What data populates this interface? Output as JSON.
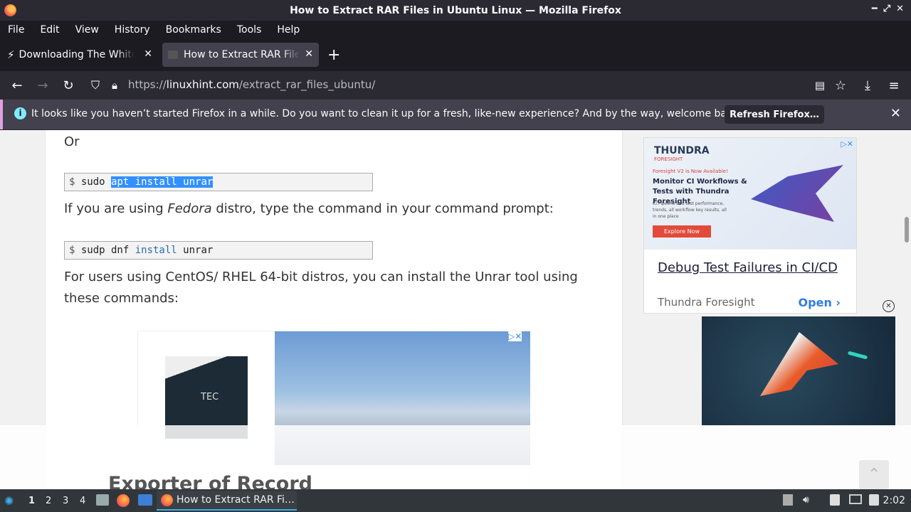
{
  "window": {
    "title": "How to Extract RAR Files in Ubuntu Linux — Mozilla Firefox"
  },
  "menu": [
    "File",
    "Edit",
    "View",
    "History",
    "Bookmarks",
    "Tools",
    "Help"
  ],
  "tabs": [
    {
      "label": "Downloading The White House",
      "active": false
    },
    {
      "label": "How to Extract RAR Files in Ubuntu Linux",
      "active": true
    }
  ],
  "navbar": {
    "url_scheme": "https://",
    "url_domain": "linuxhint.com",
    "url_path": "/extract_rar_files_ubuntu/"
  },
  "notification": {
    "message": "It looks like you haven’t started Firefox in a while. Do you want to clean it up for a fresh, like-new experience? And by the way, welcome back!",
    "button": "Refresh Firefox…"
  },
  "article": {
    "or": "Or",
    "code1": {
      "prompt": "$ ",
      "plain": "sudo ",
      "selected": "apt install unrar"
    },
    "para1_a": "If you are using ",
    "para1_em": "Fedora",
    "para1_b": " distro, type the command in your command prompt:",
    "code2": {
      "prompt": "$ ",
      "a": "sudp dnf ",
      "kw": "install",
      "b": " unrar"
    },
    "para2_l1": "For users using CentOS/ RHEL 64-bit distros, you can install the Unrar tool using",
    "para2_l2": "these commands:",
    "heading": "Exporter of Record"
  },
  "ad_right": {
    "brand": "THUNDRA",
    "brand_sub": "FORESIGHT",
    "tagline": "Foresight V2 is Now Available!",
    "title": "Monitor CI Workflows & Tests with Thundra Foresight",
    "body": "CI Pipeline and test performance, trends, all workflow key results, all in one place",
    "cta": "Explore Now",
    "headline": "Debug Test Failures in CI/CD",
    "sponsor": "Thundra Foresight",
    "open": "Open"
  },
  "ad_inline": {
    "logo_text": "TEC"
  },
  "taskbar": {
    "workspaces": [
      "1",
      "2",
      "3",
      "4"
    ],
    "current_workspace": "1",
    "task_label": "How to Extract RAR Fi…",
    "clock": "2:02"
  }
}
